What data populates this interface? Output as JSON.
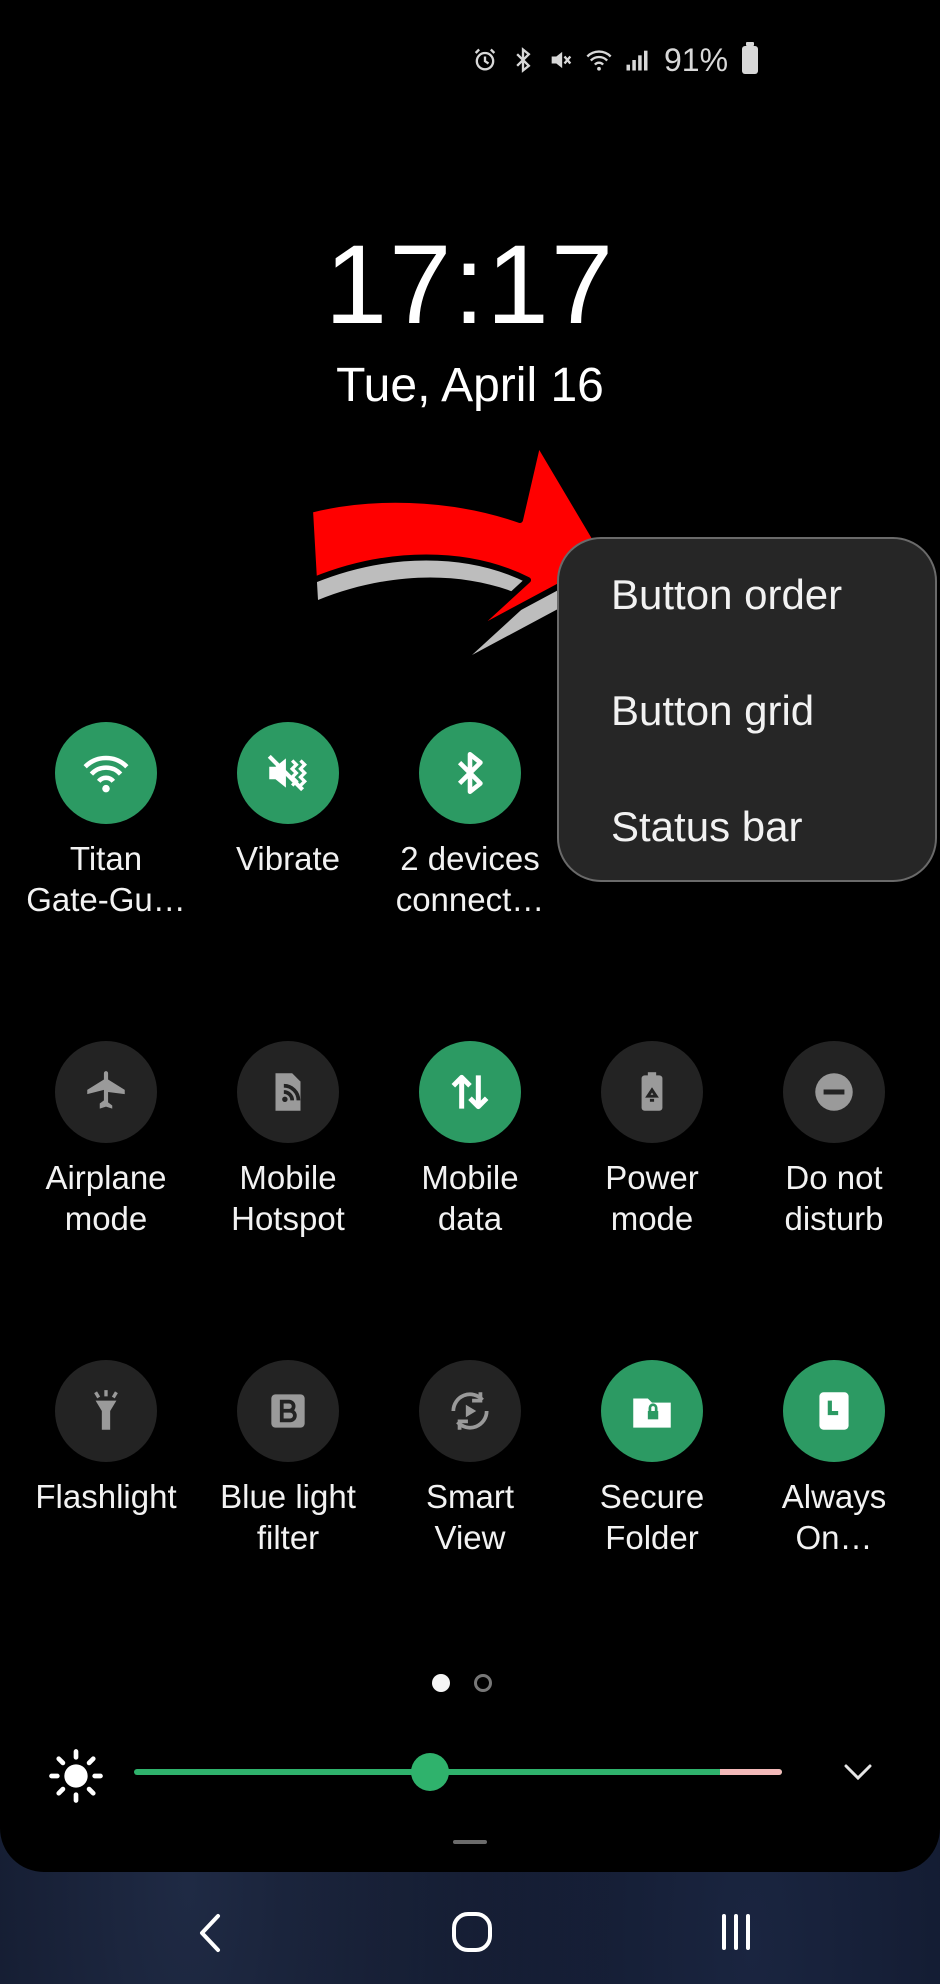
{
  "status_bar": {
    "icons": [
      "alarm-icon",
      "bluetooth-icon",
      "mute-icon",
      "wifi-icon",
      "signal-icon"
    ],
    "battery_percent": "91%"
  },
  "lock": {
    "time": "17:17",
    "date": "Tue, April 16"
  },
  "menu": {
    "items": [
      {
        "label": "Button order"
      },
      {
        "label": "Button grid"
      },
      {
        "label": "Status bar"
      }
    ]
  },
  "tiles": [
    {
      "label": "Titan\nGate-Gu…",
      "icon": "wifi-icon",
      "active": true
    },
    {
      "label": "Vibrate",
      "icon": "vibrate-icon",
      "active": true
    },
    {
      "label": "2 devices\nconnect…",
      "icon": "bluetooth-icon",
      "active": true
    },
    {
      "label": "Airplane\nmode",
      "icon": "airplane-icon",
      "active": false
    },
    {
      "label": "Mobile\nHotspot",
      "icon": "hotspot-icon",
      "active": false
    },
    {
      "label": "Mobile\ndata",
      "icon": "mobile-data-icon",
      "active": true
    },
    {
      "label": "Power\nmode",
      "icon": "power-mode-icon",
      "active": false
    },
    {
      "label": "Do not\ndisturb",
      "icon": "do-not-disturb-icon",
      "active": false
    },
    {
      "label": "Flashlight",
      "icon": "flashlight-icon",
      "active": false
    },
    {
      "label": "Blue light\nfilter",
      "icon": "blue-light-filter-icon",
      "active": false
    },
    {
      "label": "Smart\nView",
      "icon": "smart-view-icon",
      "active": false
    },
    {
      "label": "Secure\nFolder",
      "icon": "secure-folder-icon",
      "active": true
    },
    {
      "label": "Always\nOn…",
      "icon": "always-on-display-icon",
      "active": true
    }
  ],
  "pager": {
    "current_page": 1,
    "total_pages": 2
  },
  "brightness": {
    "level": 0.45
  },
  "colors": {
    "tile_active": "#2c9a63",
    "tile_inactive": "#232323",
    "slider": "#2fb26c",
    "arrow": "#ff0000"
  }
}
